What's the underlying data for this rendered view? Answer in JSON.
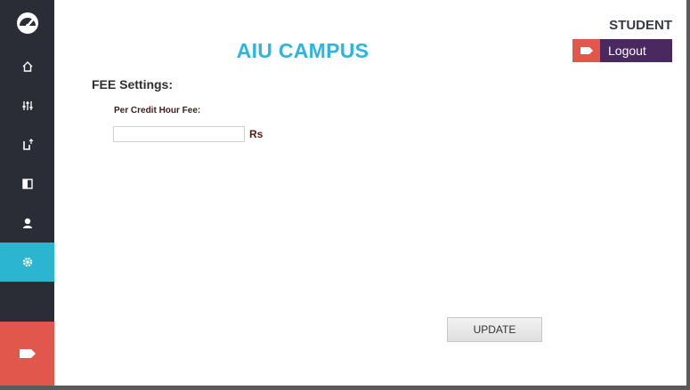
{
  "app": {
    "title": "AIU CAMPUS",
    "role": "STUDENT"
  },
  "colors": {
    "sidebar_bg": "#2b2d36",
    "active_item": "#2cb5d0",
    "accent_red": "#e2574c",
    "title_blue": "#2cb5e0",
    "logout_bg": "#4a2860"
  },
  "header": {
    "logout_label": "Logout"
  },
  "sidebar": {
    "items": [
      {
        "icon": "gauge-icon"
      },
      {
        "icon": "home-icon"
      },
      {
        "icon": "sliders-icon"
      },
      {
        "icon": "export-icon"
      },
      {
        "icon": "book-icon"
      },
      {
        "icon": "user-icon"
      },
      {
        "icon": "settings-icon",
        "active": true
      },
      {
        "icon": "logout-tag-icon"
      }
    ]
  },
  "form": {
    "section_title": "FEE Settings:",
    "per_credit_label": "Per Credit Hour Fee:",
    "per_credit_value": "",
    "unit": "Rs",
    "update_label": "UPDATE"
  }
}
